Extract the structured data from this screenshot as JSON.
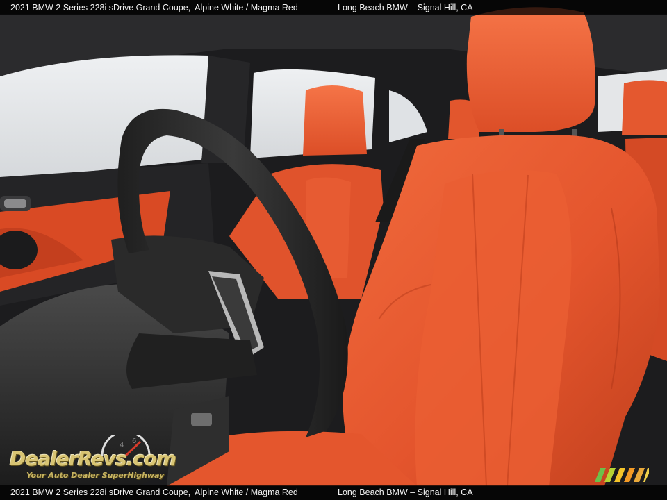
{
  "caption": {
    "vehicle": "2021 BMW 2 Series 228i sDrive Grand Coupe,",
    "color": "Alpine White / Magma Red",
    "dealer": "Long Beach BMW – Signal Hill, CA"
  },
  "watermark": {
    "brand": "DealerRevs.com",
    "tagline": "Your Auto Dealer SuperHighway"
  },
  "colors": {
    "magma_red": "#e2532c",
    "magma_red_dark": "#b8391a",
    "steering_black": "#262626",
    "window_sky": "#e6e8ea"
  }
}
